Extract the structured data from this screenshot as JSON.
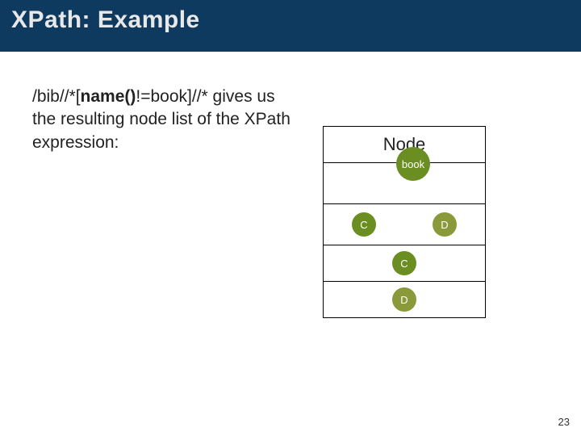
{
  "title": "XPath: Example",
  "paragraph": {
    "pre": "/bib//*[",
    "kw": "name()",
    "post": "!=book]//* gives us the resulting node list of the XPath expression:"
  },
  "table": {
    "header": "Node",
    "rows": {
      "book": "book",
      "c": "C",
      "d": "D",
      "c2": "C",
      "d2": "D"
    }
  },
  "page_number": "23"
}
